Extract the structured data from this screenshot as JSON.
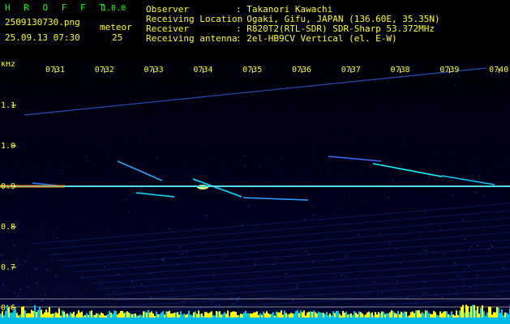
{
  "app": {
    "name": "H R O F F T",
    "version": "1.0.0"
  },
  "file": {
    "name": "2509130730.png",
    "datetime": "25.09.13 07:30"
  },
  "meteor": {
    "label": "meteor",
    "count": "25"
  },
  "info": [
    {
      "label": "Observer",
      "value": ": Takanori Kawachi"
    },
    {
      "label": "Receiving Location",
      "value": ": Ogaki, Gifu, JAPAN (136.60E, 35.35N)"
    },
    {
      "label": "Receiver",
      "value": ": R820T2(RTL-SDR) SDR-Sharp 53.372MHz"
    },
    {
      "label": "Receiving antenna",
      "value": ": 2el-HB9CV Vertical (el. E-W)"
    }
  ],
  "spectrogram": {
    "unit": "kHz",
    "time_ticks": [
      "0731",
      "0732",
      "0733",
      "0734",
      "0735",
      "0736",
      "0737",
      "0738",
      "0739",
      "0740"
    ],
    "freq_ticks": [
      "1.1",
      "1.0",
      "0.9",
      "0.8",
      "0.7",
      "0.6"
    ],
    "freq_range_khz": [
      0.57,
      1.18
    ],
    "carrier_khz": 0.9,
    "colors": {
      "background": "#000010",
      "label": "#ffff00",
      "tick": "#ffffff",
      "carrier": "#ffffaa",
      "floor": "#00ccff"
    }
  }
}
